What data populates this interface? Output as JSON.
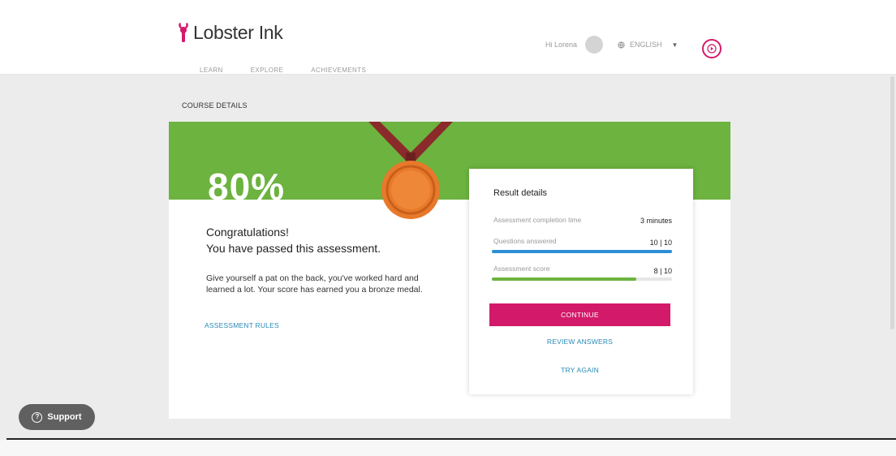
{
  "header": {
    "logo_text": "Lobster Ink",
    "nav": [
      "LEARN",
      "EXPLORE",
      "ACHIEVEMENTS"
    ],
    "greeting": "Hi Lorena",
    "language": "ENGLISH"
  },
  "page": {
    "section_title": "COURSE DETAILS",
    "score_percent": "80%",
    "congrats": "Congratulations!",
    "passed": "You have passed this assessment.",
    "message": "Give yourself a pat on the back, you've worked hard and learned a lot. Your score has earned you a bronze medal.",
    "rules_link": "ASSESSMENT RULES"
  },
  "results": {
    "title": "Result details",
    "rows": [
      {
        "label": "Assessment completion time",
        "value": "3 minutes"
      },
      {
        "label": "Questions answered",
        "value": "10 | 10",
        "progress": 1.0
      },
      {
        "label": "Assessment score",
        "value": "8 | 10",
        "progress": 0.8
      }
    ],
    "continue_label": "CONTINUE",
    "review_label": "REVIEW ANSWERS",
    "try_again_label": "TRY AGAIN"
  },
  "support": {
    "label": "Support"
  },
  "colors": {
    "accent": "#d31a6a",
    "banner_green": "#6cb33f",
    "progress_blue": "#2a8fd6",
    "progress_green": "#6cb33f",
    "medal_bronze": "#e8792b",
    "ribbon": "#8b2a2a"
  },
  "icons": {
    "logo": "lobster-icon",
    "globe": "globe-icon",
    "dropdown": "chevron-down-icon",
    "play": "play-circle-icon",
    "medal": "bronze-medal-icon",
    "support": "question-icon"
  }
}
